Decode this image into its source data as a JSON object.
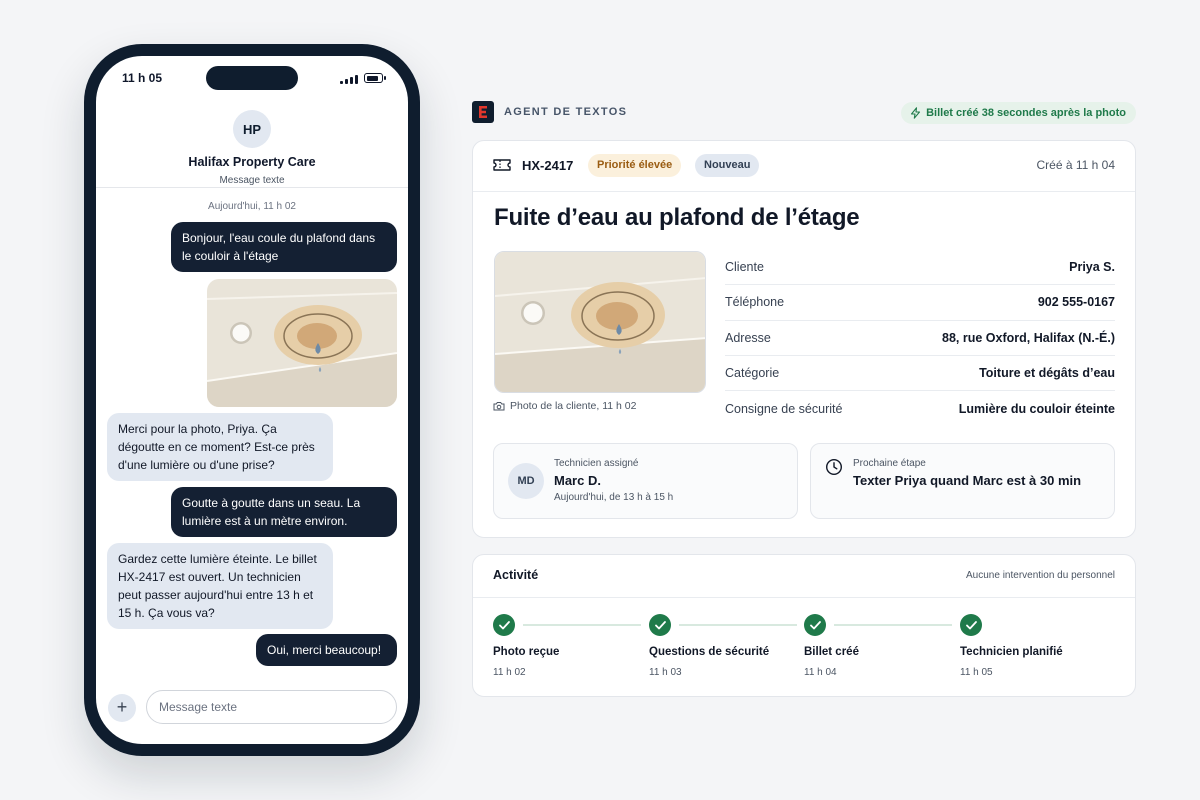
{
  "phone": {
    "status_time": "11 h 05",
    "contact": {
      "initials": "HP",
      "name": "Halifax Property Care",
      "subtitle": "Message texte"
    },
    "day_stamp": "Aujourd'hui, 11 h 02",
    "messages": [
      {
        "direction": "outgoing",
        "text": "Bonjour, l'eau coule du plafond dans le couloir à l'étage"
      },
      {
        "direction": "outgoing",
        "type": "photo"
      },
      {
        "direction": "incoming",
        "text": "Merci pour la photo, Priya. Ça dégoutte en ce moment? Est-ce près d'une lumière ou d'une prise?"
      },
      {
        "direction": "outgoing",
        "text": "Goutte à goutte dans un seau. La lumière est à un mètre environ."
      },
      {
        "direction": "incoming",
        "text": "Gardez cette lumière éteinte. Le billet HX-2417 est ouvert. Un technicien peut passer aujourd'hui entre 13 h et 15 h. Ça vous va?"
      },
      {
        "direction": "outgoing",
        "text": "Oui, merci beaucoup!"
      }
    ],
    "composer": {
      "add_icon": "plus-icon",
      "placeholder": "Message texte"
    }
  },
  "agent_header": {
    "logo_letter": "E",
    "title": "AGENT DE TEXTOS",
    "created_badge": "Billet créé 38 secondes après la photo"
  },
  "ticket": {
    "id": "HX-2417",
    "priority": "Priorité élevée",
    "status": "Nouveau",
    "created_at": "Créé à 11 h 04",
    "title": "Fuite d’eau au plafond de l’étage",
    "photo_caption": "Photo de la cliente, 11 h 02",
    "details": [
      {
        "label": "Cliente",
        "value": "Priya S."
      },
      {
        "label": "Téléphone",
        "value": "902 555-0167"
      },
      {
        "label": "Adresse",
        "value": "88, rue Oxford, Halifax (N.-É.)"
      },
      {
        "label": "Catégorie",
        "value": "Toiture et dégâts d’eau"
      },
      {
        "label": "Consigne de sécurité",
        "value": "Lumière du couloir éteinte"
      }
    ],
    "technician": {
      "label": "Technicien assigné",
      "initials": "MD",
      "name": "Marc D.",
      "window": "Aujourd'hui, de 13 h à 15 h"
    },
    "next_step": {
      "label": "Prochaine étape",
      "value": "Texter Priya quand Marc est à 30 min"
    }
  },
  "activity": {
    "title": "Activité",
    "note": "Aucune intervention du personnel",
    "steps": [
      {
        "label": "Photo reçue",
        "time": "11 h 02",
        "done": true
      },
      {
        "label": "Questions de sécurité",
        "time": "11 h 03",
        "done": true
      },
      {
        "label": "Billet créé",
        "time": "11 h 04",
        "done": true
      },
      {
        "label": "Technicien planifié",
        "time": "11 h 05",
        "done": true
      }
    ]
  },
  "colors": {
    "navy": "#0f1d2e",
    "brand_red": "#e0362c",
    "success_green": "#1f7a4a",
    "priority_amber": "#9a5c12",
    "bubble_incoming": "#e2e8f1"
  }
}
